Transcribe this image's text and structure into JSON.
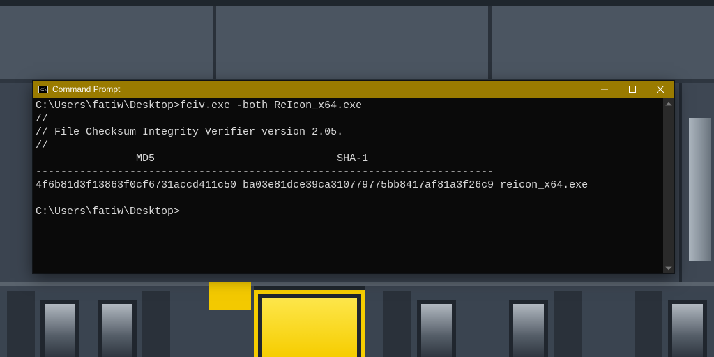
{
  "window": {
    "title": "Command Prompt",
    "icon_name": "cmd-icon",
    "buttons": {
      "minimize": "minimize",
      "maximize": "maximize",
      "close": "close"
    }
  },
  "terminal": {
    "prompt_path": "C:\\Users\\fatiw\\Desktop>",
    "command": "fciv.exe -both ReIcon_x64.exe",
    "lines": {
      "l1": "//",
      "l2": "// File Checksum Integrity Verifier version 2.05.",
      "l3": "//",
      "header_md5": "                MD5",
      "header_sha1": "                             SHA-1",
      "sep": "-------------------------------------------------------------------------",
      "md5": "4f6b81d3f13863f0cf6731accd411c50",
      "sha1": "ba03e81dce39ca310779775bb8417af81a3f26c9",
      "file": "reicon_x64.exe"
    }
  },
  "colors": {
    "titlebar": "#9a7b00",
    "terminal_bg": "#0a0a0a",
    "terminal_fg": "#d9d9d9",
    "desktop": "#3a4450",
    "highlight_yellow": "#f6cd00"
  }
}
